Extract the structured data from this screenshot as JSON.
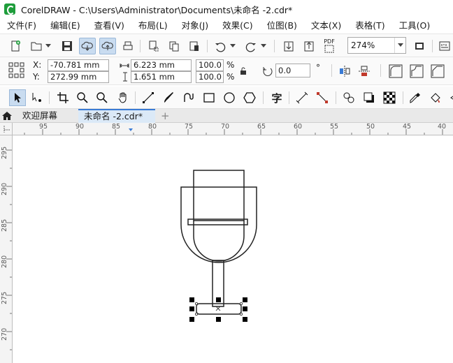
{
  "window": {
    "title": "CorelDRAW - C:\\Users\\Administrator\\Documents\\未命名 -2.cdr*"
  },
  "menu": [
    "文件(F)",
    "编辑(E)",
    "查看(V)",
    "布局(L)",
    "对象(J)",
    "效果(C)",
    "位图(B)",
    "文本(X)",
    "表格(T)",
    "工具(O)"
  ],
  "toolbar": {
    "zoom_value": "274%",
    "pdf_label": "PDF"
  },
  "properties": {
    "x_label": "X:",
    "y_label": "Y:",
    "x_value": "-70.781 mm",
    "y_value": "272.99 mm",
    "width_value": "6.223 mm",
    "height_value": "1.651 mm",
    "scale_w": "100.0",
    "scale_h": "100.0",
    "percent": "%",
    "rotation": "0.0",
    "degree_symbol": "°"
  },
  "toolbox_icons": [
    "pick-tool",
    "shape-tool",
    "crop-tool",
    "zoom-tool",
    "zoom-out-tool",
    "pan-tool",
    "freehand-tool",
    "artistic-media-tool",
    "smart-drawing-tool",
    "rectangle-tool",
    "ellipse-tool",
    "polygon-tool",
    "text-tool",
    "dimension-tool",
    "connector-tool",
    "blend-tool",
    "drop-shadow-tool",
    "transparency-tool",
    "eyedropper-tool",
    "fill-tool"
  ],
  "tabs": {
    "welcome": "欢迎屏幕",
    "document": "未命名 -2.cdr*",
    "add": "+"
  },
  "ruler_h": [
    "95",
    "90",
    "85",
    "80",
    "75",
    "70",
    "65",
    "60",
    "55",
    "50",
    "45",
    "40"
  ],
  "ruler_v": [
    "295",
    "290",
    "285",
    "280",
    "275",
    "270"
  ],
  "colors": {
    "accent": "#3a7bd5",
    "selection_bg": "#c9dcf0"
  }
}
